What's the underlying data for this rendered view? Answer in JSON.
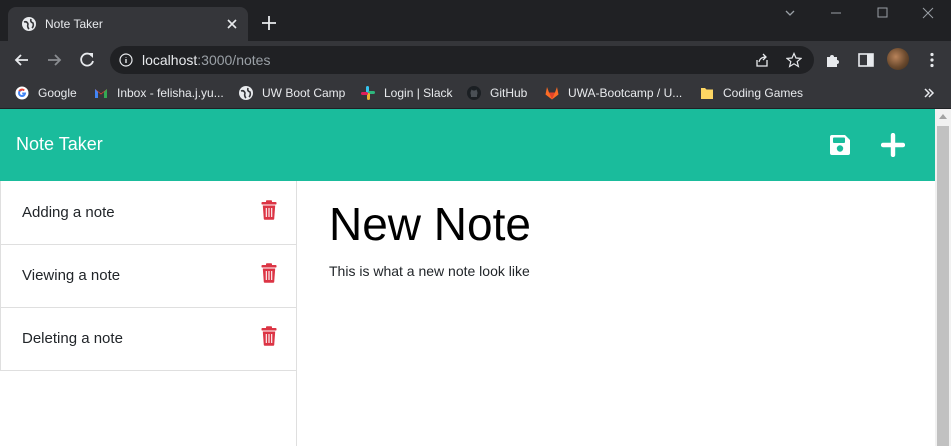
{
  "browser": {
    "tab_title": "Note Taker",
    "url_host": "localhost",
    "url_path": ":3000/notes",
    "bookmarks": [
      {
        "label": "Google",
        "icon": "google-icon"
      },
      {
        "label": "Inbox - felisha.j.yu...",
        "icon": "gmail-icon"
      },
      {
        "label": "UW Boot Camp",
        "icon": "globe-icon"
      },
      {
        "label": "Login | Slack",
        "icon": "slack-icon"
      },
      {
        "label": "GitHub",
        "icon": "github-icon"
      },
      {
        "label": "UWA-Bootcamp / U...",
        "icon": "gitlab-icon"
      },
      {
        "label": "Coding Games",
        "icon": "bookmark-folder-icon"
      }
    ]
  },
  "app": {
    "brand": "Note Taker",
    "accent_color": "#1abc9c",
    "delete_color": "#dc3545",
    "notes": [
      {
        "title": "Adding a note"
      },
      {
        "title": "Viewing a note"
      },
      {
        "title": "Deleting a note"
      }
    ],
    "active_note": {
      "title": "New Note",
      "text": "This is what a new note look like"
    }
  }
}
